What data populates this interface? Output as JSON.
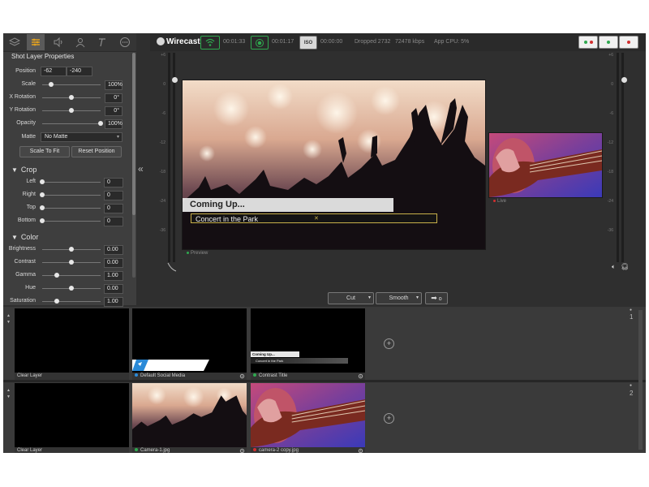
{
  "app": {
    "name": "Wirecast"
  },
  "left_tabs": [
    "layers-icon",
    "properties-icon",
    "audio-icon",
    "person-icon",
    "text-icon",
    "more-icon"
  ],
  "properties": {
    "title": "Shot Layer Properties",
    "position_label": "Position",
    "position_x": "-62",
    "position_y": "-240",
    "rows": [
      {
        "label": "Scale",
        "value": "100%",
        "level": 0.15
      },
      {
        "label": "X Rotation",
        "value": "0°",
        "level": 0.5
      },
      {
        "label": "Y Rotation",
        "value": "0°",
        "level": 0.5
      },
      {
        "label": "Opacity",
        "value": "100%",
        "level": 1.0
      }
    ],
    "matte_label": "Matte",
    "matte_value": "No Matte",
    "scale_to_fit": "Scale To Fit",
    "reset_position": "Reset Position"
  },
  "crop": {
    "title": "Crop",
    "rows": [
      {
        "label": "Left",
        "value": "0",
        "level": 0.0
      },
      {
        "label": "Right",
        "value": "0",
        "level": 0.0
      },
      {
        "label": "Top",
        "value": "0",
        "level": 0.0
      },
      {
        "label": "Bottom",
        "value": "0",
        "level": 0.0
      }
    ]
  },
  "color": {
    "title": "Color",
    "rows": [
      {
        "label": "Brightness",
        "value": "0.00",
        "level": 0.5
      },
      {
        "label": "Contrast",
        "value": "0.00",
        "level": 0.5
      },
      {
        "label": "Gamma",
        "value": "1.00",
        "level": 0.25
      },
      {
        "label": "Hue",
        "value": "0.00",
        "level": 0.5
      },
      {
        "label": "Saturation",
        "value": "1.00",
        "level": 0.25
      }
    ]
  },
  "status": {
    "stream_time": "00:01:33",
    "record_time": "00:01:17",
    "iso_label": "ISO",
    "iso_time": "00:00:00",
    "dropped": "Dropped 2732",
    "bitrate": "72478 kbps",
    "cpu": "App CPU: 5%"
  },
  "meter_scale": [
    "+6",
    "0",
    "-6",
    "-12",
    "-18",
    "-24",
    "-36"
  ],
  "preview": {
    "caption": "Preview",
    "title_text": "Coming Up...",
    "subtitle_text": "Concert in the Park"
  },
  "live": {
    "caption": "Live"
  },
  "transitions": {
    "cut": "Cut",
    "smooth": "Smooth",
    "go_label": "o"
  },
  "shots": {
    "row1": {
      "number": "1",
      "items": [
        {
          "label": "Clear Layer",
          "status": "none"
        },
        {
          "label": "Default Social Media",
          "status": "blue"
        },
        {
          "label": "Contrast Title",
          "status": "green",
          "title_line": "Coming Up...",
          "sub_line": "Concert in the Park"
        }
      ]
    },
    "row2": {
      "number": "2",
      "items": [
        {
          "label": "Clear Layer",
          "status": "none"
        },
        {
          "label": "Camera-1.jpg",
          "status": "green"
        },
        {
          "label": "camera-2 copy.jpg",
          "status": "red"
        }
      ]
    }
  },
  "colors": {
    "accent_green": "#2fa84f",
    "live_red": "#d22f2f",
    "social_blue": "#2a8ad8",
    "title_outline": "#c8b04a"
  }
}
